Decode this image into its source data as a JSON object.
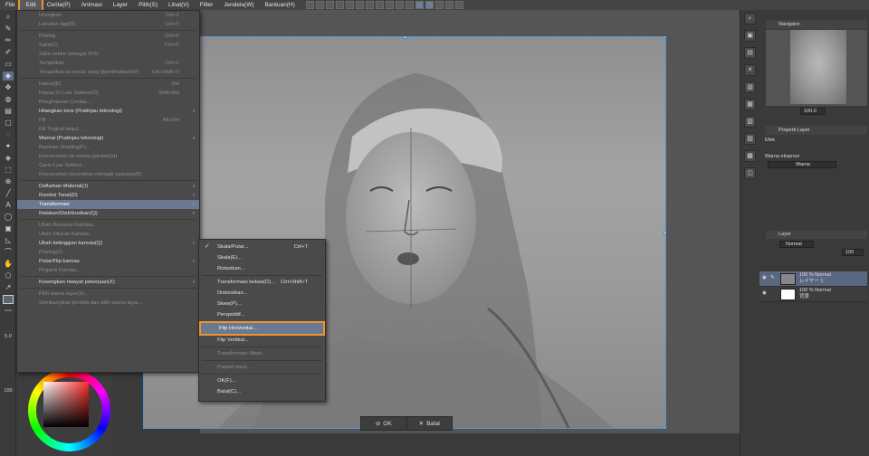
{
  "menubar": {
    "items": [
      "File",
      "Edit",
      "Cerita(P)",
      "Animasi",
      "Layer",
      "Pilih(S)",
      "Lihat(V)",
      "Filter",
      "Jendela(W)",
      "Bantuan(H)"
    ]
  },
  "edit_menu": {
    "items": [
      {
        "label": "Urungkan",
        "shortcut": "Ctrl+Z",
        "disabled": true
      },
      {
        "label": "Lakukan lagi(R)",
        "shortcut": "Ctrl+Y",
        "disabled": true
      },
      {
        "sep": true
      },
      {
        "label": "Potong",
        "shortcut": "Ctrl+X",
        "disabled": true
      },
      {
        "label": "Salin(C)",
        "shortcut": "Ctrl+C",
        "disabled": true
      },
      {
        "label": "Salin vektor sebagai SVG",
        "disabled": true
      },
      {
        "label": "Tempelkan",
        "shortcut": "Ctrl+V",
        "disabled": true
      },
      {
        "label": "Tempelkan ke posisi yang diperlihatkan(W)",
        "shortcut": "Ctrl+Shift+V",
        "disabled": true
      },
      {
        "sep": true
      },
      {
        "label": "Hapus(E)",
        "shortcut": "Del",
        "disabled": true
      },
      {
        "label": "Hapus Di Luar Seleksi(O)",
        "shortcut": "Shift+Del",
        "disabled": true
      },
      {
        "label": "Penghaluran Cerdas...",
        "disabled": true
      },
      {
        "label": "Hilangkan tone (Pratinjau teknologi)",
        "arrow": true
      },
      {
        "label": "Fill",
        "shortcut": "Alt+Del",
        "disabled": true
      },
      {
        "label": "Fill Tingkat lanjut...",
        "disabled": true
      },
      {
        "label": "Warnai (Pratinjau teknologi)",
        "arrow": true
      },
      {
        "label": "Bantuan Shading(F)...",
        "disabled": true
      },
      {
        "label": "Konversikan ke warna gambar(H)",
        "disabled": true
      },
      {
        "label": "Garis Luar Seleksi...",
        "disabled": true
      },
      {
        "label": "Konversikan kecerahan menjadi opasitas(B)",
        "disabled": true
      },
      {
        "sep": true
      },
      {
        "label": "Daftarkan Material(J)",
        "arrow": true
      },
      {
        "label": "Koreksi Tonal(D)",
        "arrow": true
      },
      {
        "label": "Transformasi",
        "arrow": true,
        "highlighted": true
      },
      {
        "label": "Ratakan/Distribusikan(Q)",
        "arrow": true
      },
      {
        "sep": true
      },
      {
        "label": "Ubah Resolusi Gambar...",
        "disabled": true
      },
      {
        "label": "Ubah Ukuran Kanvas...",
        "disabled": true
      },
      {
        "label": "Ubah ketinggian kanvas(Q)",
        "arrow": true
      },
      {
        "label": "Potong(Z)",
        "disabled": true
      },
      {
        "label": "Putar/Flip kanvas",
        "arrow": true
      },
      {
        "label": "Properti Kanvas...",
        "disabled": true
      },
      {
        "sep": true
      },
      {
        "label": "Kosongkan riwayat pekerjaan(X)",
        "arrow": true
      },
      {
        "sep": true
      },
      {
        "label": "Pilih warna layar(X)...",
        "disabled": true
      },
      {
        "label": "Sembunyikan jendela dan pilih warna layar...",
        "disabled": true
      }
    ]
  },
  "transform_submenu": {
    "items": [
      {
        "label": "Skala/Putar...",
        "shortcut": "Ctrl+T",
        "checked": true
      },
      {
        "label": "Skala(E)..."
      },
      {
        "label": "Rotasikan..."
      },
      {
        "sep": true
      },
      {
        "label": "Transformasi bebas(D)...",
        "shortcut": "Ctrl+Shift+T"
      },
      {
        "label": "Distorsikan..."
      },
      {
        "label": "Skew(P)..."
      },
      {
        "label": "Perspektif..."
      },
      {
        "sep": true
      },
      {
        "label": "Flip Horizontal...",
        "flip": true
      },
      {
        "label": "Flip Vertikal..."
      },
      {
        "sep": true
      },
      {
        "label": "Transformasi Mesh...",
        "disabled": true
      },
      {
        "sep": true
      },
      {
        "label": "Puppet warp...",
        "disabled": true
      },
      {
        "sep": true
      },
      {
        "label": "OK(F)..."
      },
      {
        "label": "Batal(C)..."
      }
    ]
  },
  "transform_bar": {
    "ok": "OK",
    "cancel": "Batal"
  },
  "navigator": {
    "tab": "Navigator",
    "zoom": "100.0"
  },
  "properties": {
    "tab": "Properti Layer",
    "effect": "Efek",
    "expression_label": "Warna ekspresi",
    "expression_value": "Warna"
  },
  "layers": {
    "tab": "Layer",
    "blend_mode": "Normal",
    "opacity": "100",
    "rows": [
      {
        "line1": "100 % Normal",
        "line2": "レイヤー 1",
        "selected": true
      },
      {
        "line1": "100 % Normal",
        "line2": "背景",
        "selected": false
      }
    ]
  },
  "left_status": {
    "brush_size": "5.0",
    "opacity": "100"
  }
}
